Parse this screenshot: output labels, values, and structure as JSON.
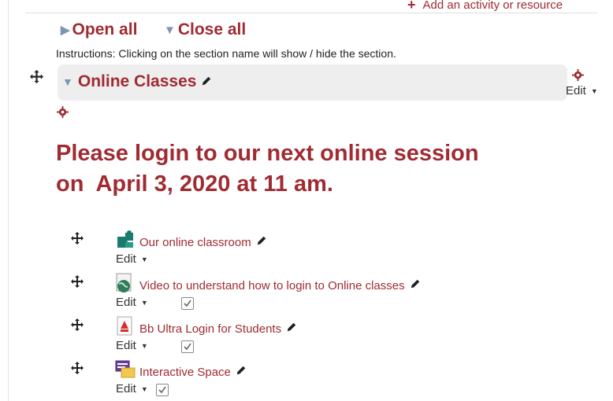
{
  "header": {
    "add_activity_label": "Add an activity or resource"
  },
  "controls": {
    "open_all": "Open all",
    "close_all": "Close all"
  },
  "instructions": "Instructions: Clicking on the section name will show / hide the section.",
  "section": {
    "title": "Online Classes",
    "edit_label": "Edit",
    "announcement": "Please login to our next online session\non  April 3, 2020 at 11 am."
  },
  "activities": [
    {
      "name": "Our online classroom",
      "edit_label": "Edit",
      "icon": "puzzle-icon",
      "completion": false
    },
    {
      "name": "Video to understand how to login to Online classes",
      "edit_label": "Edit",
      "icon": "url-globe-icon",
      "completion": true
    },
    {
      "name": "Bb Ultra Login for Students",
      "edit_label": "Edit",
      "icon": "pdf-icon",
      "completion": true
    },
    {
      "name": "Interactive Space",
      "edit_label": "Edit",
      "icon": "chat-icon",
      "completion": true
    }
  ],
  "colors": {
    "accent": "#a02b32",
    "triangle": "#7d96b2",
    "section_bg": "#eeeeee"
  }
}
